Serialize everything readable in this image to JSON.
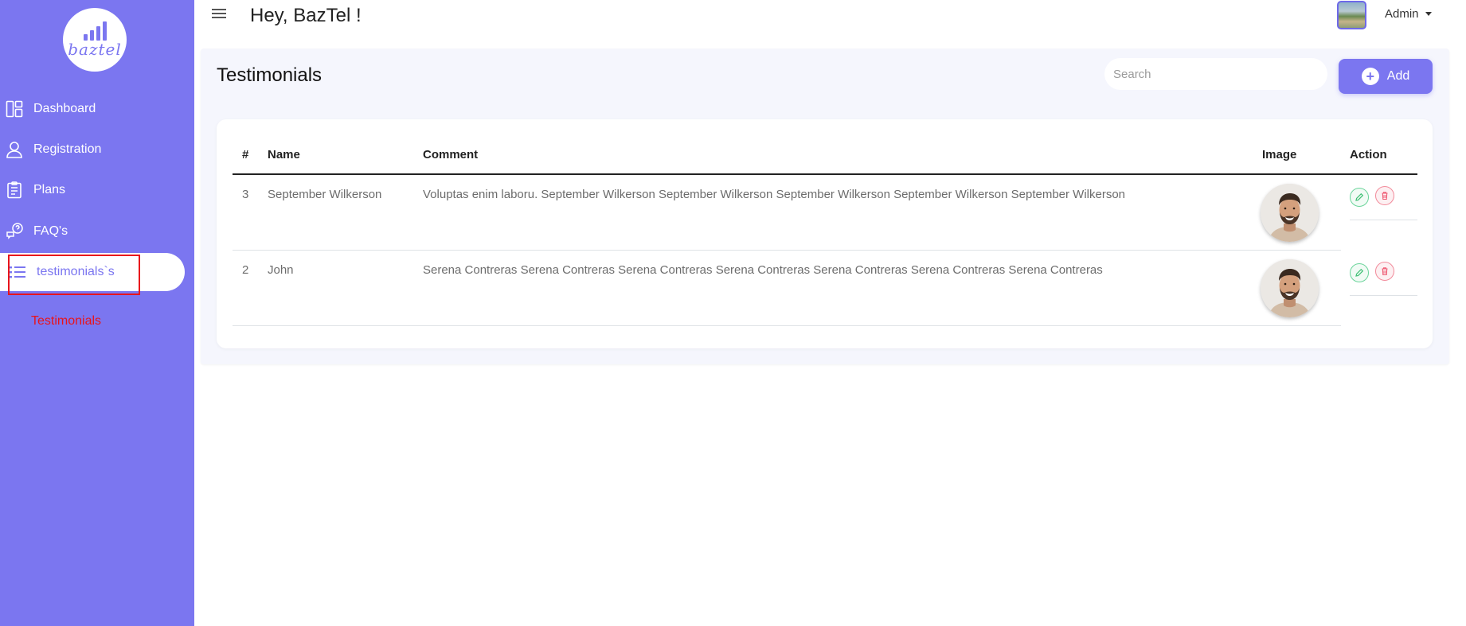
{
  "header": {
    "greeting": "Hey, BazTel !",
    "user_label": "Admin"
  },
  "sidebar": {
    "logo_text": "baztel",
    "items": [
      {
        "label": "Dashboard",
        "icon": "dashboard-icon"
      },
      {
        "label": "Registration",
        "icon": "user-icon"
      },
      {
        "label": "Plans",
        "icon": "clipboard-icon"
      },
      {
        "label": "FAQ's",
        "icon": "faq-icon"
      },
      {
        "label": "testimonials`s",
        "icon": "list-icon",
        "active": true
      }
    ],
    "submenu": {
      "label": "Testimonials"
    }
  },
  "main": {
    "title": "Testimonials",
    "search_placeholder": "Search",
    "add_label": "Add"
  },
  "table": {
    "columns": [
      "#",
      "Name",
      "Comment",
      "Image",
      "Action"
    ],
    "rows": [
      {
        "id": "3",
        "name": "September Wilkerson",
        "comment": "Voluptas enim laboru. September Wilkerson September Wilkerson September Wilkerson September Wilkerson September Wilkerson",
        "image": "person-photo"
      },
      {
        "id": "2",
        "name": "John",
        "comment": "Serena Contreras Serena Contreras Serena Contreras Serena Contreras Serena Contreras Serena Contreras Serena Contreras",
        "image": "person-photo"
      }
    ]
  },
  "colors": {
    "sidebar": "#7b76f0",
    "highlight": "#e8141c",
    "edit": "#6ad49a",
    "delete": "#f28a9a"
  }
}
